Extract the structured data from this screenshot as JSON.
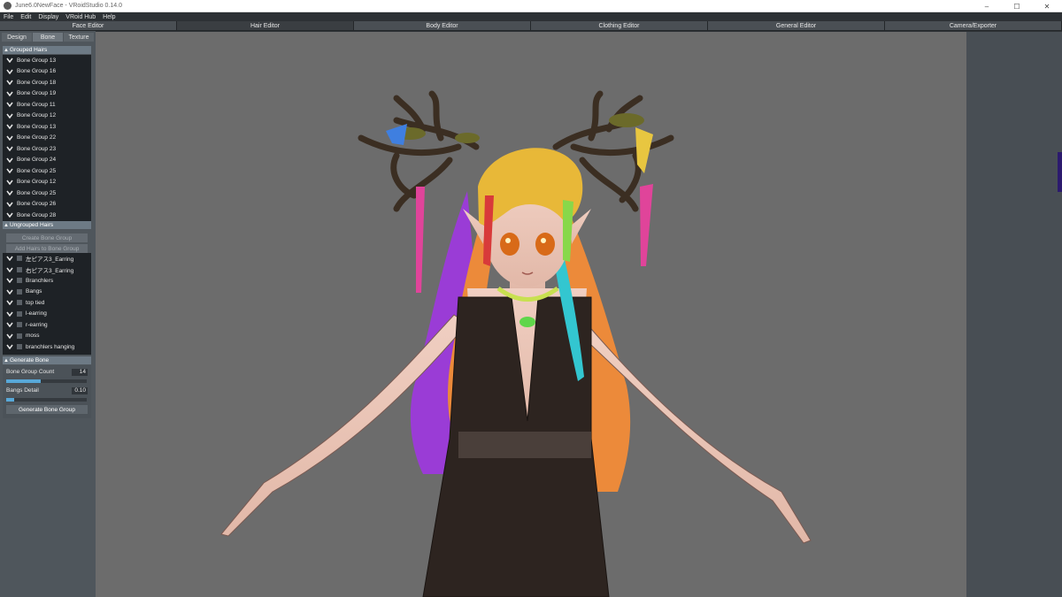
{
  "titlebar": {
    "title": "June6.0NewFace - VRoidStudio 0.14.0",
    "minimize": "–",
    "maximize": "☐",
    "close": "✕"
  },
  "menu": [
    "File",
    "Edit",
    "Display",
    "VRoid Hub",
    "Help"
  ],
  "editor_tabs": [
    "Face Editor",
    "Hair Editor",
    "Body Editor",
    "Clothing Editor",
    "General Editor",
    "Camera/Exporter"
  ],
  "sub_tabs": [
    "Design",
    "Bone",
    "Texture"
  ],
  "grouped_hairs": {
    "header": "Grouped Hairs",
    "items": [
      "Bone Group 13",
      "Bone Group 16",
      "Bone Group 18",
      "Bone Group 19",
      "Bone Group 11",
      "Bone Group 12",
      "Bone Group 13",
      "Bone Group 22",
      "Bone Group 23",
      "Bone Group 24",
      "Bone Group 25",
      "Bone Group 12",
      "Bone Group 25",
      "Bone Group 26",
      "Bone Group 28"
    ]
  },
  "ungrouped_hairs": {
    "header": "Ungrouped Hairs",
    "create_button": "Create Bone Group",
    "add_button": "Add Hairs to Bone Group",
    "items": [
      "左ピアス3_Earring",
      "右ピアス3_Earring",
      "Branchlers",
      "Bangs",
      "top tied",
      "l-earring",
      "r-earring",
      "moss",
      "branchlers hanging"
    ]
  },
  "generate_bone": {
    "header": "Generate Bone",
    "count_label": "Bone Group Count",
    "count_value": "14",
    "count_fraction": 0.43,
    "bangs_label": "Bangs Detail",
    "bangs_value": "0.10",
    "bangs_fraction": 0.1,
    "button": "Generate Bone Group"
  },
  "colors": {
    "accent": "#58a8d8",
    "viewport_bg": "#6c6c6c",
    "panel_bg": "#4f565c"
  }
}
